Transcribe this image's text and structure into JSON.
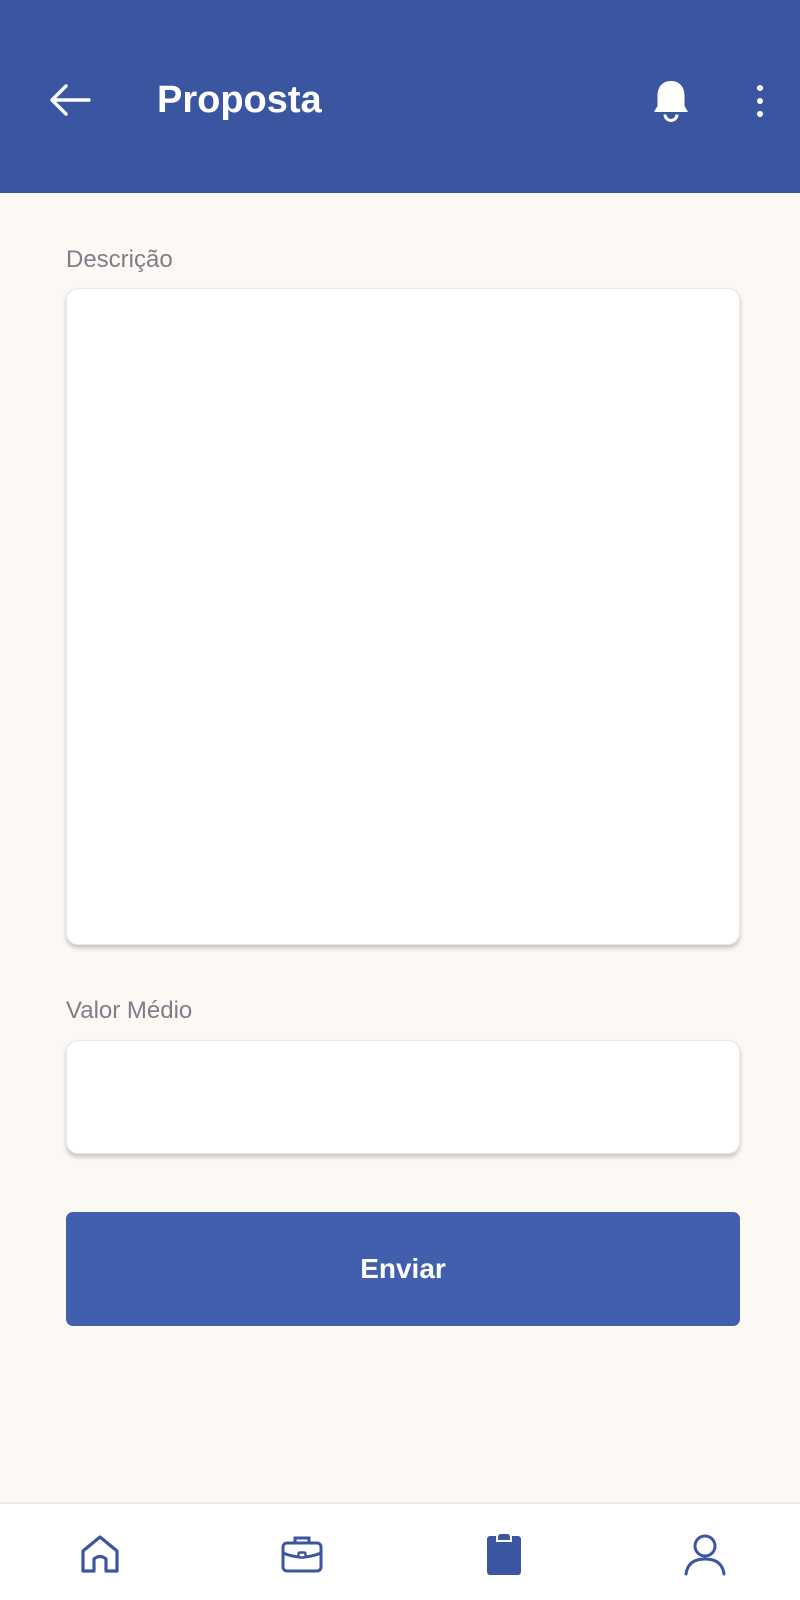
{
  "header": {
    "title": "Proposta",
    "background_color": "#3b56a0",
    "back_icon": "arrow-left-icon",
    "notification_icon": "bell-icon",
    "menu_icon": "more-vertical-icon"
  },
  "form": {
    "description": {
      "label": "Descrição",
      "value": "",
      "placeholder": ""
    },
    "average_value": {
      "label": "Valor Médio",
      "value": "",
      "placeholder": ""
    },
    "submit_label": "Enviar",
    "submit_color": "#425fae"
  },
  "bottom_nav": {
    "items": [
      {
        "icon": "home-icon",
        "active": false
      },
      {
        "icon": "briefcase-icon",
        "active": false
      },
      {
        "icon": "clipboard-icon",
        "active": true
      },
      {
        "icon": "user-icon",
        "active": false
      }
    ],
    "accent_color": "#3b56a0"
  },
  "page_background": "#fcf9f5"
}
